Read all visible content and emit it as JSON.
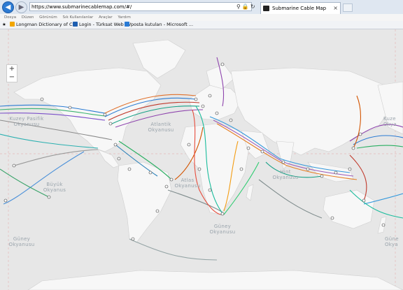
{
  "browser": {
    "url": "https://www.submarinecablemap.com/#/",
    "tab_title": "Submarine Cable Map",
    "back_icon": "back-arrow-icon",
    "forward_icon": "forward-arrow-icon",
    "menu": [
      "Dosya",
      "Düzen",
      "Görünüm",
      "Sık Kullanılanlar",
      "Araçlar",
      "Yardım"
    ],
    "favorites": [
      {
        "label": "Longman Dictionary of C...",
        "icon": "longman-icon"
      },
      {
        "label": "Login - Türksat Web TV",
        "icon": "turksat-icon"
      },
      {
        "label": "posta kutuları - Microsoft ...",
        "icon": "outlook-icon"
      }
    ]
  },
  "map": {
    "zoom_in": "+",
    "zoom_out": "−",
    "oceans": {
      "north_pacific_left": "Kuzey Pasifik\nOkyanusu",
      "north_pacific_right": "Kuze\nOkya",
      "atlantic": "Atlantik\nOkyanusu",
      "south_pacific": "Büyük\nOkyanus",
      "south_atlantic": "Atlas\nOkyanusu",
      "indian": "Hint\nOkyanusu",
      "southern": "Güney\nOkyanusu",
      "southern_left": "Güney\nOkyanusu",
      "southern_right": "Güne\nOkya"
    },
    "colors": {
      "water": "#e7e7e7",
      "land": "#f7f7f7",
      "land_border": "#cfcfcf"
    }
  }
}
